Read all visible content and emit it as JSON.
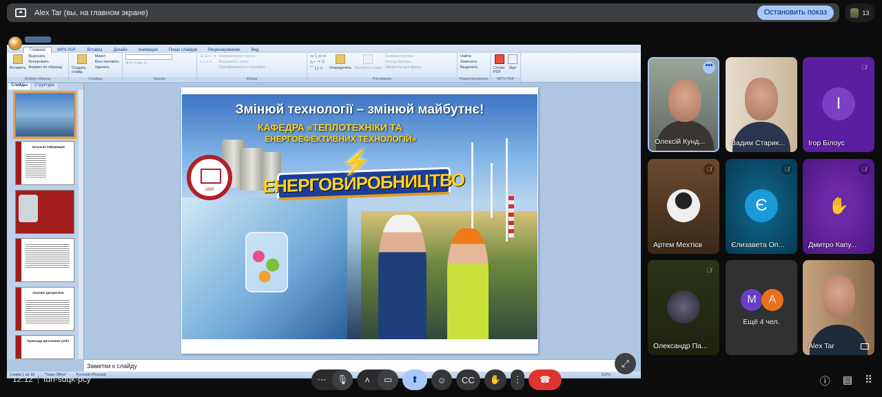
{
  "topbar": {
    "title": "Alex Tar (вы, на главном экране)",
    "stop_button": "Остановить показ",
    "participant_count": "13"
  },
  "powerpoint": {
    "tabs": [
      "Главная",
      "WPS PDF",
      "Вставка",
      "Дизайн",
      "Анимация",
      "Показ слайдов",
      "Рецензирование",
      "Вид"
    ],
    "ribbon": {
      "clipboard": {
        "paste": "Вставить",
        "cut": "Вырезать",
        "copy": "Копировать",
        "format_painter": "Формат по образцу",
        "label": "Буфер обмена"
      },
      "slides": {
        "new_slide": "Создать слайд",
        "layout": "Макет",
        "reset": "Восстановить",
        "delete": "Удалить",
        "label": "Слайды"
      },
      "font": {
        "label": "Шрифт"
      },
      "paragraph": {
        "text_direction": "Направление текста",
        "align_text": "Выровнять текст",
        "smartart": "Преобразовать в SmartArt",
        "label": "Абзац"
      },
      "drawing": {
        "arrange": "Упорядочить",
        "quick_styles": "Экспресс-стили",
        "fill": "Заливка фигуры",
        "outline": "Контур фигуры",
        "effects": "Эффекты для фигур",
        "label": "Рисование"
      },
      "editing": {
        "find": "Найти",
        "replace": "Заменить",
        "select": "Выделить",
        "label": "Редактирование"
      },
      "wps": {
        "create_pdf": "Create PDF",
        "sign": "Sign",
        "label": "WPS PDF"
      }
    },
    "panel_tabs": [
      "Слайды",
      "Структура"
    ],
    "thumbnails": [
      {
        "num": "1",
        "title": ""
      },
      {
        "num": "2",
        "title": "Загальна інформація"
      },
      {
        "num": "3",
        "title": ""
      },
      {
        "num": "4",
        "title": ""
      },
      {
        "num": "5",
        "title": "Основні дисципліни"
      },
      {
        "num": "6",
        "title": "Приклади дипломних робіт"
      }
    ],
    "slide": {
      "headline": "Змінюй технології – змінюй майбутнє!",
      "dept_line1": "КАФЕДРА «ТЕПЛОТЕХНІКИ ТА",
      "dept_line2": "ЕНЕРГОЕФЕКТИВНИХ ТЕХНОЛОГІЙ»",
      "banner": "ЕНЕРГОВИРОБНИЦТВО",
      "seal_year": "1885"
    },
    "notes_placeholder": "Заметки к слайду",
    "status": {
      "slide": "Слайд 1 из 18",
      "theme": "\"Тема Office\"",
      "language": "Русский (Россия)",
      "zoom": "112%"
    }
  },
  "participants": [
    {
      "name": "Олексій Кунд...",
      "muted": false
    },
    {
      "name": "Вадим Старик...",
      "muted": false
    },
    {
      "name": "Ігор Білоус",
      "initial": "І",
      "muted": true
    },
    {
      "name": "Артем Мехтієв",
      "muted": true
    },
    {
      "name": "Єлизавета Оп...",
      "initial": "Є",
      "muted": true
    },
    {
      "name": "Дмитро Капу...",
      "muted": true
    },
    {
      "name": "Олександр Па...",
      "muted": true
    },
    {
      "name": "Ещё 4 чел.",
      "initials": [
        "M",
        "A"
      ]
    },
    {
      "name": "Alex Tar",
      "muted": false
    }
  ],
  "meeting": {
    "time": "12:12",
    "code": "tdn-sdqk-pcy"
  },
  "colors": {
    "accent": "#a8c7fa",
    "end_call": "#dc362e",
    "tile_purple": "#5b1ea0",
    "tile_teal": "#0b4d6e"
  }
}
